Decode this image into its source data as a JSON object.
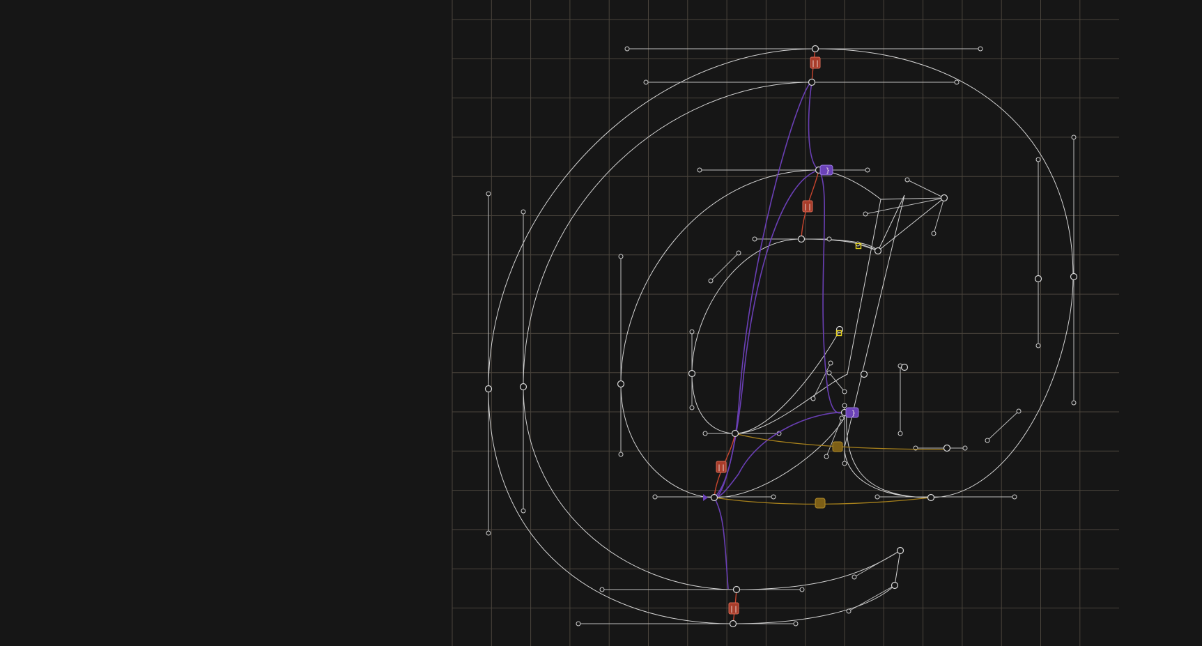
{
  "canvas": {
    "background": "#161616",
    "grid_color": "#4a443c",
    "outline_color": "#d4d4d4"
  },
  "glyph": {
    "character": "@"
  },
  "constraints": {
    "red_badge_glyph": "||",
    "purple_badge_glyph": "}",
    "colors": {
      "distance": "#c8452e",
      "interpolation": "#6a3fb5",
      "alignment": "#a9821c",
      "selection": "#e6d21e"
    }
  }
}
